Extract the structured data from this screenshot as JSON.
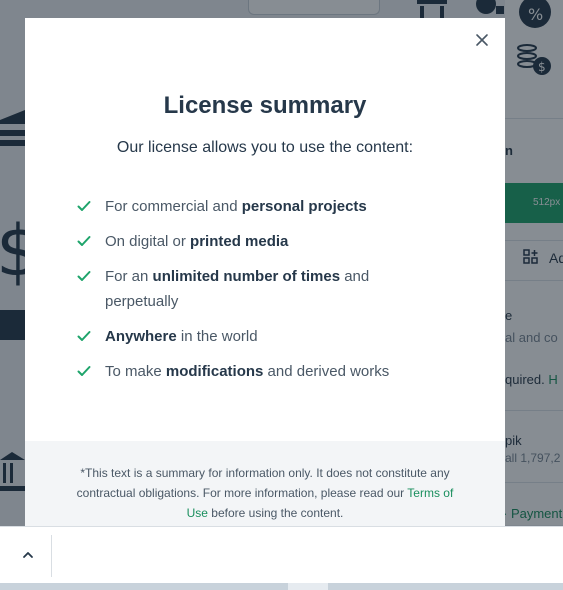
{
  "background": {
    "green_button_text": "512px",
    "side_texts": [
      "n",
      "e",
      "al and co",
      "quired.",
      "H",
      "pik",
      "all 1,797,2",
      "Payment",
      "Ad"
    ]
  },
  "modal": {
    "title": "License summary",
    "subtitle": "Our license allows you to use the content:",
    "items": [
      {
        "pre": "For commercial and ",
        "bold": "personal projects",
        "post": ""
      },
      {
        "pre": "On digital or ",
        "bold": "printed media",
        "post": ""
      },
      {
        "pre": "For an ",
        "bold": "unlimited number of times",
        "post": " and perpetually"
      },
      {
        "pre": "",
        "bold": "Anywhere",
        "post": " in the world"
      },
      {
        "pre": "To make ",
        "bold": "modifications",
        "post": " and derived works"
      }
    ],
    "footnote_pre": "*This text is a summary for information only. It does not constitute any contractual obligations. For more information, please read our ",
    "footnote_link": "Terms of Use",
    "footnote_post": " before using the content."
  },
  "icons": {
    "close": "close-icon",
    "check": "check-icon",
    "collapse": "chevron-up-icon"
  },
  "colors": {
    "accent": "#1ea46b",
    "title": "#26384a",
    "text": "#4a5866"
  }
}
